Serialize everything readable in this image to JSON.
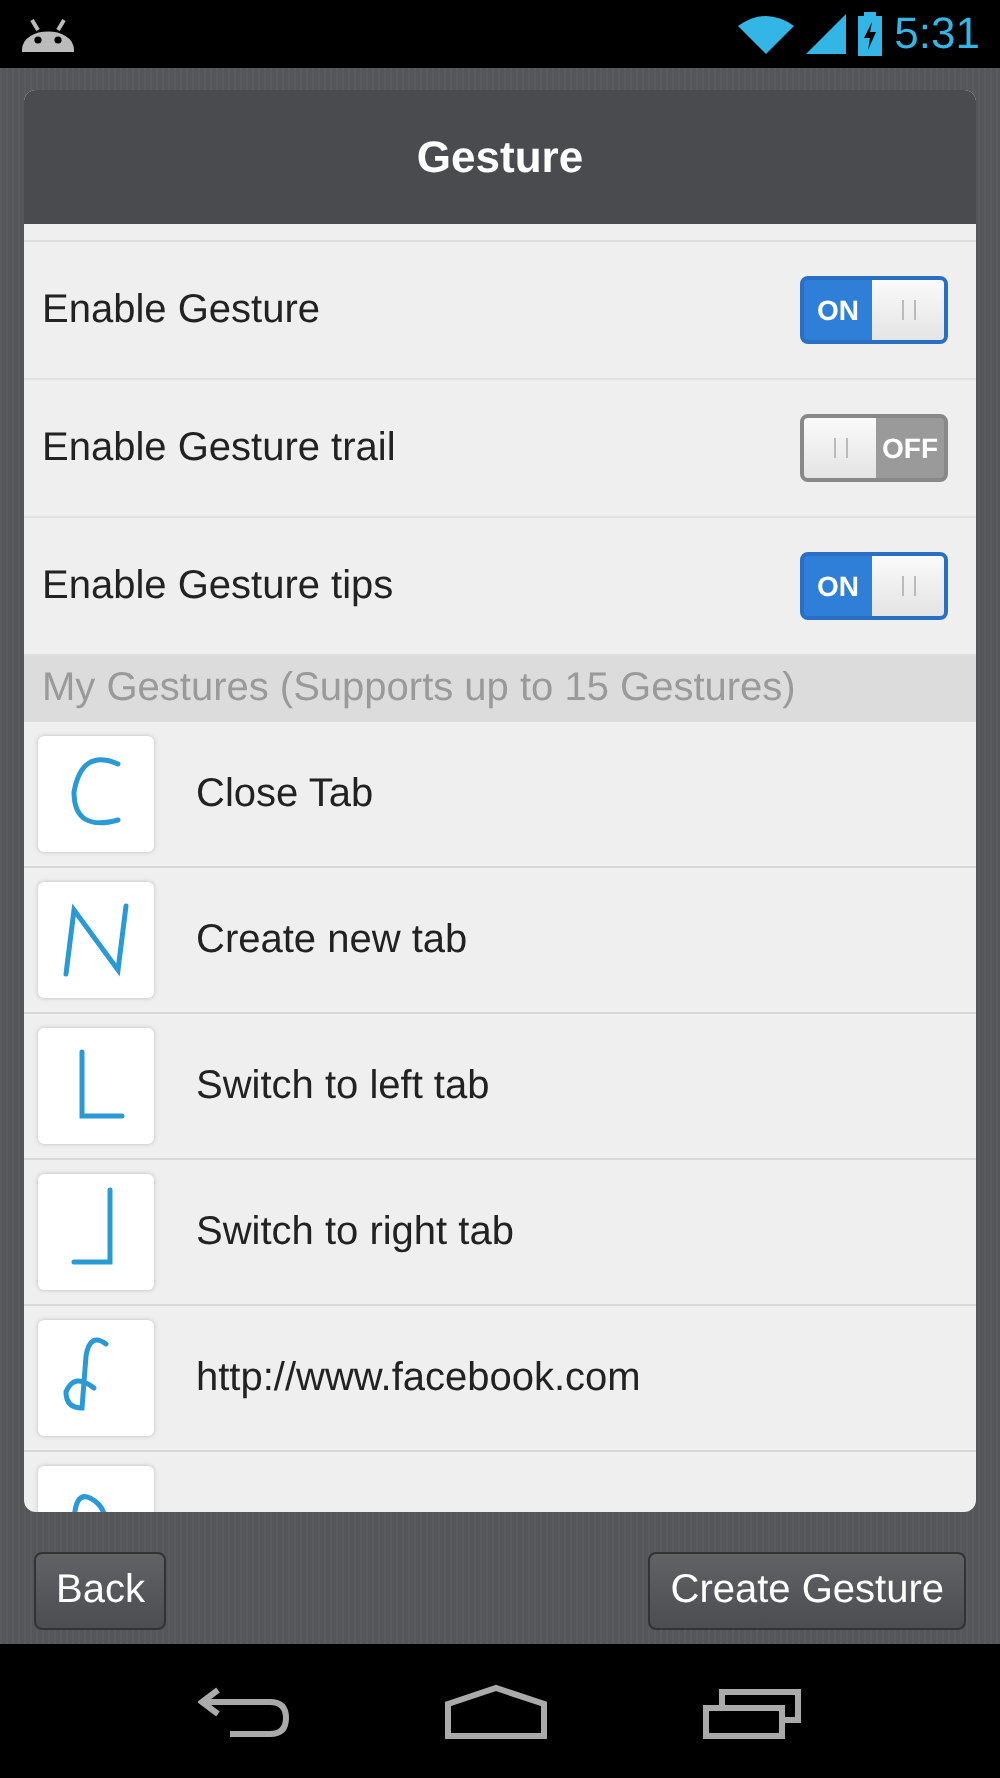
{
  "status_bar": {
    "time": "5:31"
  },
  "dialog": {
    "title": "Gesture"
  },
  "settings": [
    {
      "label": "Enable Gesture",
      "on": true,
      "switch_text": "ON"
    },
    {
      "label": "Enable Gesture trail",
      "on": false,
      "switch_text": "OFF"
    },
    {
      "label": "Enable Gesture tips",
      "on": true,
      "switch_text": "ON"
    }
  ],
  "gestures_header": "My Gestures (Supports up to 15 Gestures)",
  "gestures": [
    {
      "kind": "c",
      "label": "Close Tab"
    },
    {
      "kind": "n",
      "label": "Create new tab"
    },
    {
      "kind": "l",
      "label": "Switch to left tab"
    },
    {
      "kind": "j",
      "label": "Switch to right tab"
    },
    {
      "kind": "f",
      "label": "http://www.facebook.com"
    },
    {
      "kind": "loop"
    }
  ],
  "buttons": [
    "Back",
    "Create Gesture"
  ]
}
